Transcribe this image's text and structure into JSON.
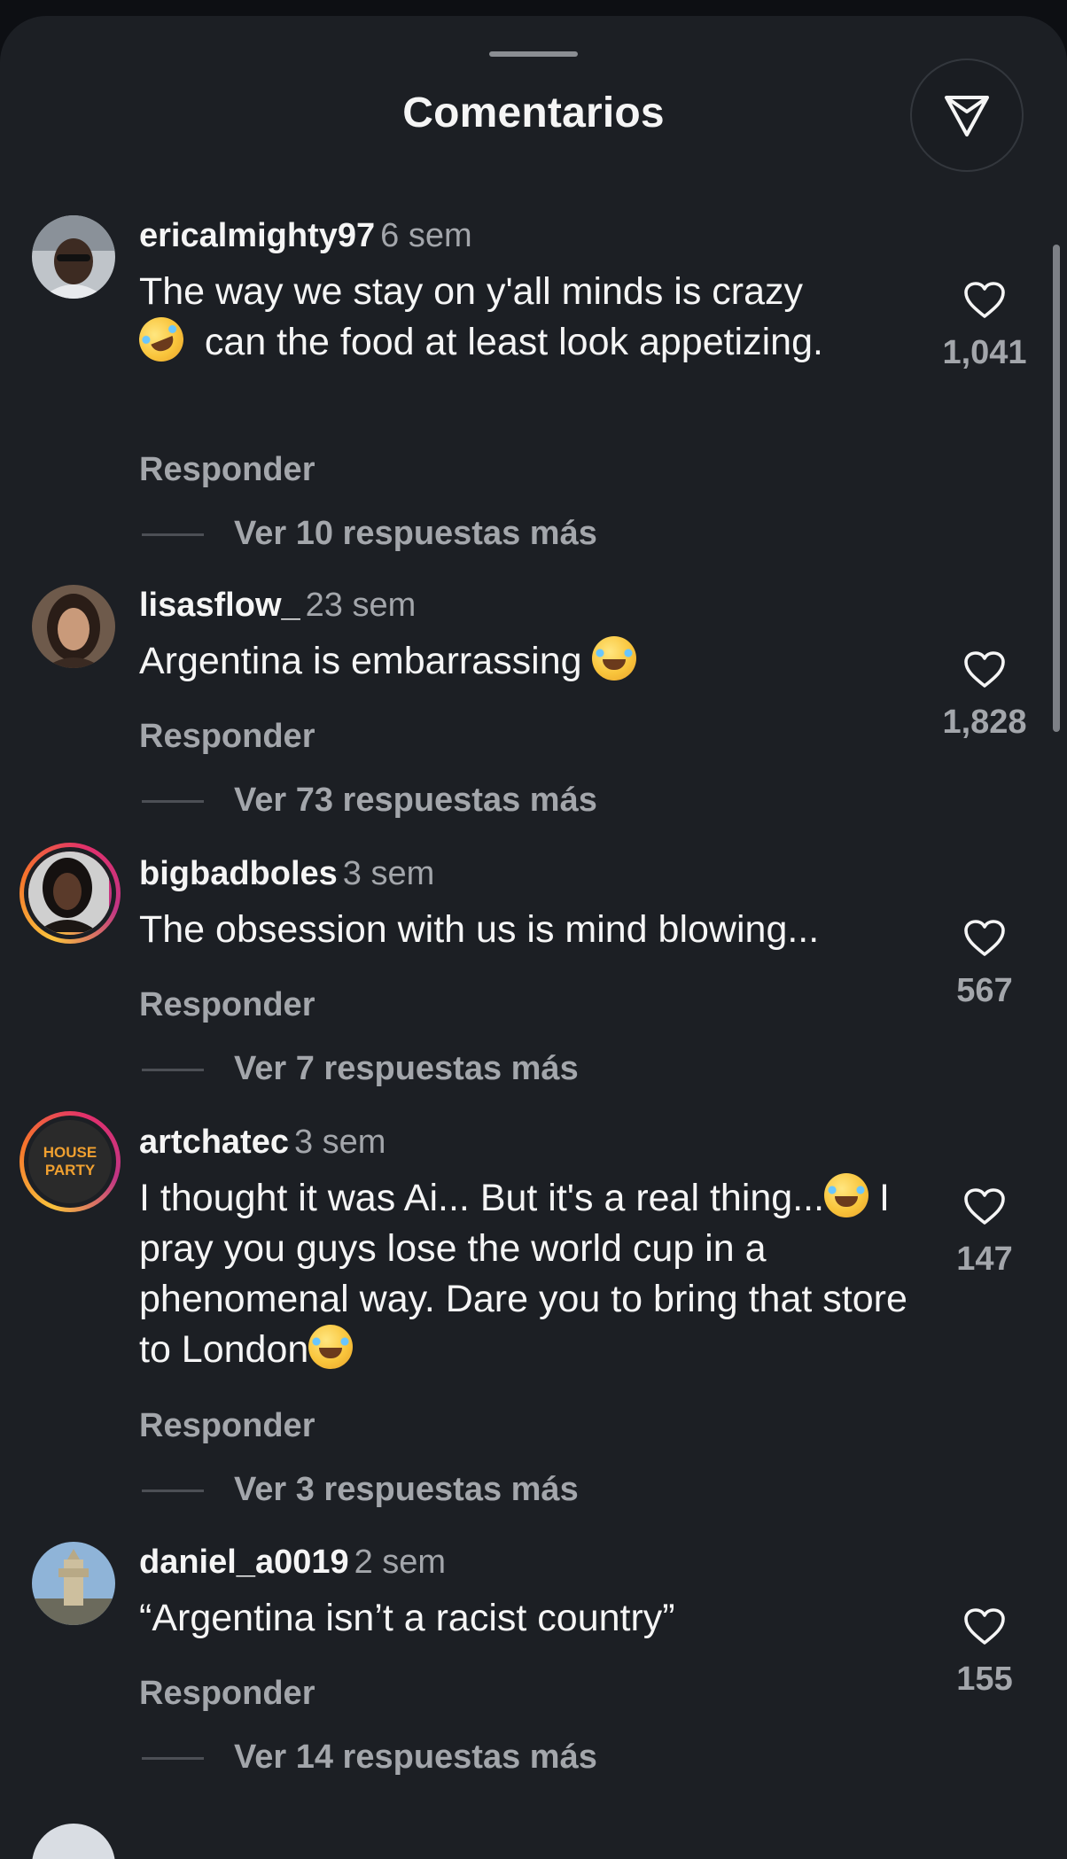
{
  "header": {
    "title": "Comentarios"
  },
  "comments": [
    {
      "username": "ericalmighty97",
      "time": "6 sem",
      "text_parts": [
        "The way we stay on y'all minds is crazy",
        "can the food at least look appetizing."
      ],
      "likes": "1,041",
      "reply_label": "Responder",
      "replies_label": "Ver 10 respuestas más"
    },
    {
      "username": "lisasflow_",
      "time": "23 sem",
      "text_parts": [
        "Argentina is embarrassing"
      ],
      "likes": "1,828",
      "reply_label": "Responder",
      "replies_label": "Ver 73 respuestas más"
    },
    {
      "username": "bigbadboles",
      "time": "3 sem",
      "text_parts": [
        "The obsession with us is mind blowing..."
      ],
      "likes": "567",
      "reply_label": "Responder",
      "replies_label": "Ver 7 respuestas más"
    },
    {
      "username": "artchatec",
      "avatar_text": "HOUSE PARTY",
      "time": "3 sem",
      "text_parts": [
        "I thought it was Ai... But it's a real thing...",
        "I pray you guys lose the world cup in a phenomenal way. Dare you to bring that store to London"
      ],
      "likes": "147",
      "reply_label": "Responder",
      "replies_label": "Ver 3 respuestas más"
    },
    {
      "username": "daniel_a0019",
      "time": "2 sem",
      "text_parts": [
        "“Argentina isn’t a racist country”"
      ],
      "likes": "155",
      "reply_label": "Responder",
      "replies_label": "Ver 14 respuestas más"
    }
  ],
  "icons": {
    "filter": "send-filter-icon",
    "like": "heart-icon",
    "emoji": "laughing-emoji"
  },
  "colors": {
    "background": "#1c1f24",
    "text": "#f5f5f5",
    "secondary": "#a3a6ab"
  }
}
